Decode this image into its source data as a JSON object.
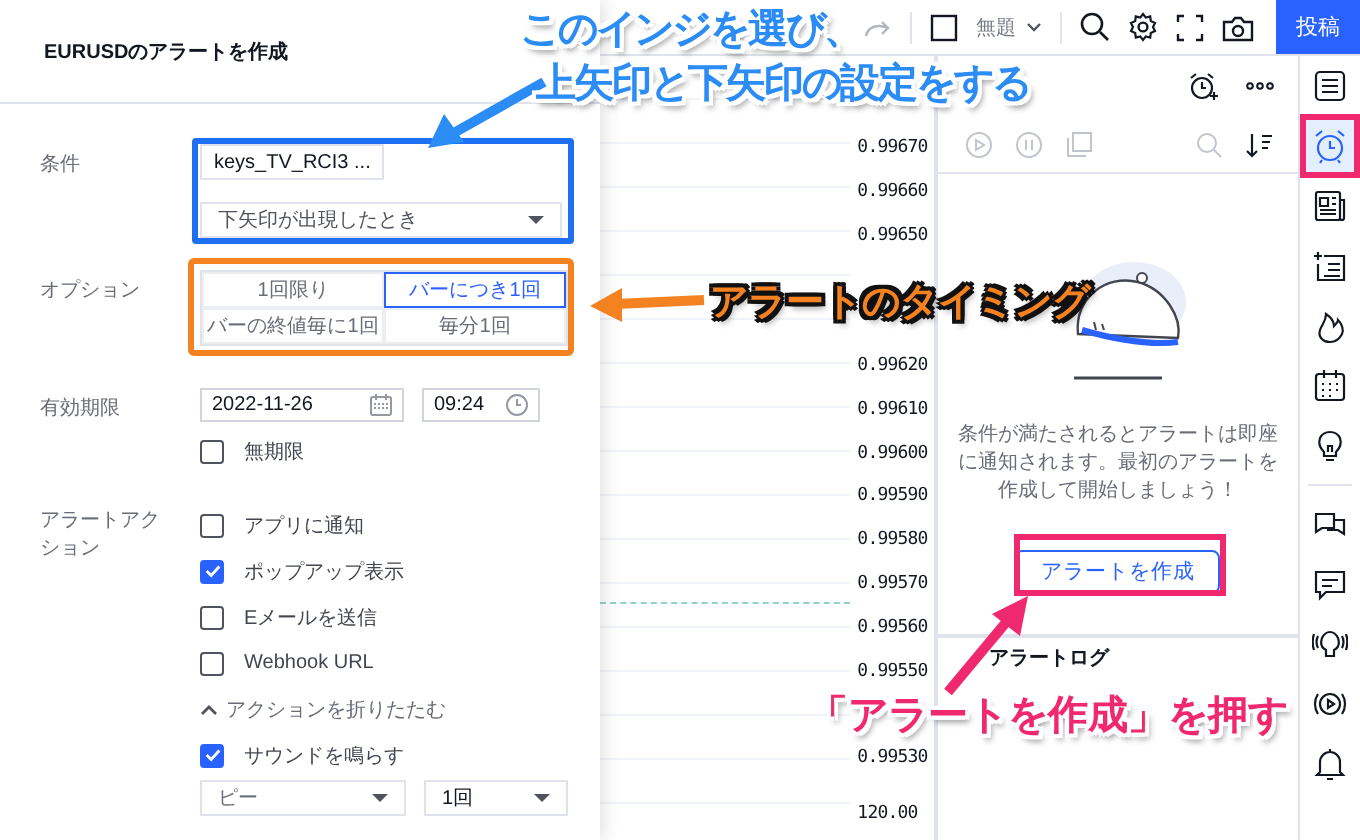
{
  "toolbar": {
    "layout_name": "無題",
    "publish_button": "投稿"
  },
  "dialog": {
    "title": "EURUSDのアラートを作成",
    "condition": {
      "label": "条件",
      "indicator": "keys_TV_RCI3 ...",
      "trigger": "下矢印が出現したとき"
    },
    "options": {
      "label": "オプション",
      "choices": [
        {
          "label": "1回限り",
          "selected": false
        },
        {
          "label": "バーにつき1回",
          "selected": true
        },
        {
          "label": "バーの終値毎に1回",
          "selected": false
        },
        {
          "label": "毎分1回",
          "selected": false
        }
      ]
    },
    "expiration": {
      "label": "有効期限",
      "date": "2022-11-26",
      "time": "09:24",
      "no_expiry": {
        "label": "無期限",
        "checked": false
      }
    },
    "actions": {
      "label": "アラートアクション",
      "items": [
        {
          "label": "アプリに通知",
          "checked": false
        },
        {
          "label": "ポップアップ表示",
          "checked": true
        },
        {
          "label": "Eメールを送信",
          "checked": false
        },
        {
          "label": "Webhook URL",
          "checked": false
        }
      ],
      "collapse": "アクションを折りたたむ",
      "sound": {
        "label": "サウンドを鳴らす",
        "checked": true,
        "tone": "ピー",
        "repeat": "1回"
      }
    }
  },
  "price_axis": {
    "groups": [
      [
        "0.99670",
        "0.99660",
        "0.99650"
      ],
      [
        "0.99620",
        "0.99610",
        "0.99600",
        "0.99590",
        "0.99580",
        "0.99570",
        "0.99560",
        "0.99550"
      ],
      [
        "0.99530"
      ],
      [
        "120.00"
      ]
    ]
  },
  "alerts_panel": {
    "empty_message": "条件が満たされるとアラートは即座に通知されます。最初のアラートを作成して開始しましょう！",
    "create_button": "アラートを作成",
    "log_title": "アラートログ"
  },
  "sidebar": {
    "groups": [
      [
        {
          "kind": "watchlist",
          "selected": false
        },
        {
          "kind": "alerts",
          "selected": true
        },
        {
          "kind": "news",
          "selected": false
        },
        {
          "kind": "notes",
          "selected": false
        },
        {
          "kind": "hotlist",
          "selected": false
        },
        {
          "kind": "calendar",
          "selected": false
        },
        {
          "kind": "ideas",
          "selected": false
        }
      ],
      [
        {
          "kind": "chats",
          "selected": false
        },
        {
          "kind": "messages",
          "selected": false
        },
        {
          "kind": "streams",
          "selected": false
        },
        {
          "kind": "broadcast",
          "selected": false
        },
        {
          "kind": "notifications",
          "selected": false
        }
      ]
    ]
  },
  "callouts": [
    {
      "kind": "blue",
      "lines": [
        "このインジを選び、",
        "上矢印と下矢印の設定をする"
      ]
    },
    {
      "kind": "orange",
      "lines": [
        "アラートのタイミング"
      ]
    },
    {
      "kind": "pink",
      "lines": [
        "「アラートを作成」を押す"
      ]
    }
  ]
}
